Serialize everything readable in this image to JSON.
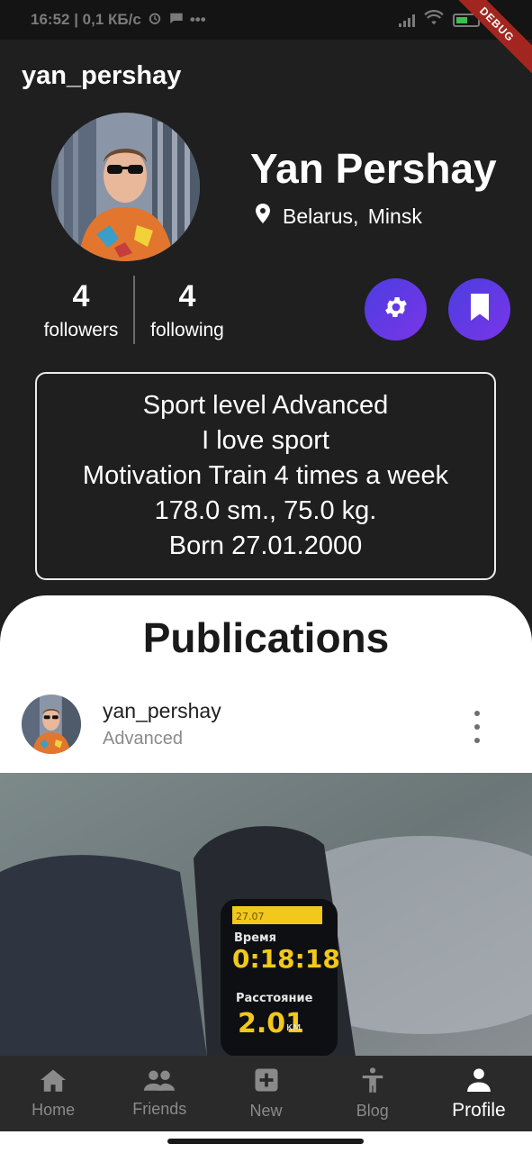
{
  "status_bar": {
    "time_info": "16:52 | 0,1 КБ/с",
    "debug_label": "DEBUG"
  },
  "header": {
    "username": "yan_pershay"
  },
  "profile": {
    "name": "Yan Pershay",
    "country": "Belarus,",
    "city": "Minsk",
    "followers_count": "4",
    "followers_label": "followers",
    "following_count": "4",
    "following_label": "following"
  },
  "bio": {
    "lines": [
      "Sport level Advanced",
      "I love sport",
      "Motivation Train 4 times a week",
      "178.0 sm., 75.0 kg.",
      "Born 27.01.2000"
    ]
  },
  "publications": {
    "title": "Publications",
    "post": {
      "username": "yan_pershay",
      "level": "Advanced"
    }
  },
  "watch_screen": {
    "time_label": "Время",
    "time_value": "0:18:18",
    "distance_label": "Расстояние",
    "distance_value": "2.01",
    "distance_unit": "км"
  },
  "nav": {
    "items": [
      {
        "label": "Home",
        "icon": "home-icon"
      },
      {
        "label": "Friends",
        "icon": "people-icon"
      },
      {
        "label": "New",
        "icon": "add-box-icon"
      },
      {
        "label": "Blog",
        "icon": "accessibility-icon"
      },
      {
        "label": "Profile",
        "icon": "person-icon"
      }
    ],
    "active_index": 4
  },
  "colors": {
    "background": "#1f1f1f",
    "accent_gradient_start": "#4b3ee0",
    "accent_gradient_end": "#7a35e8",
    "nav_bg": "#2a2a2a",
    "debug_ribbon": "#a2261f"
  }
}
